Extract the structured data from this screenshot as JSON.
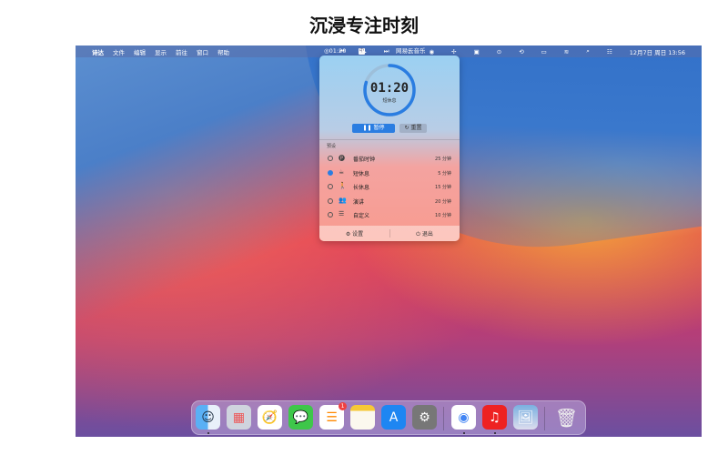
{
  "page_title": "沉浸专注时刻",
  "menubar": {
    "items": [
      "诗达",
      "文件",
      "编辑",
      "显示",
      "前往",
      "窗口",
      "帮助"
    ],
    "timer": "◎01:20",
    "ime": "中",
    "app_name": "网易云音乐",
    "datetime": "12月7日 周日 13:56"
  },
  "popup": {
    "time": "01:20",
    "mode": "短休息",
    "remaining_fraction": 0.8,
    "accent": "#2a7de1",
    "pause_label": "暂停",
    "reset_label": "重置",
    "preset_header": "预设",
    "presets": [
      {
        "label": "番茄时钟",
        "duration": "25 分钟",
        "icon": "🅟",
        "selected": false
      },
      {
        "label": "短休息",
        "duration": "5 分钟",
        "icon": "☕",
        "selected": true
      },
      {
        "label": "长休息",
        "duration": "15 分钟",
        "icon": "🚶",
        "selected": false
      },
      {
        "label": "演讲",
        "duration": "20 分钟",
        "icon": "👥",
        "selected": false
      },
      {
        "label": "自定义",
        "duration": "10 分钟",
        "icon": "☰",
        "selected": false
      }
    ],
    "settings_label": "设置",
    "quit_label": "退出"
  },
  "dock": {
    "reminders_badge": "1"
  }
}
